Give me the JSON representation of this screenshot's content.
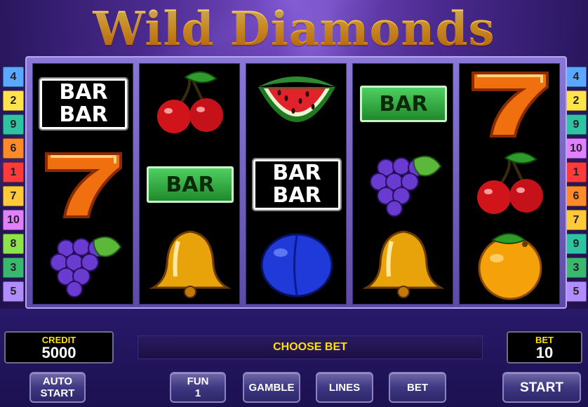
{
  "game": {
    "title_part1": "Wild",
    "title_part2": "Diamonds"
  },
  "paylines_left": [
    "4",
    "2",
    "9",
    "6",
    "1",
    "7",
    "10",
    "8",
    "3",
    "5"
  ],
  "paylines_right": [
    "4",
    "2",
    "9",
    "10",
    "1",
    "6",
    "7",
    "9",
    "3",
    "5"
  ],
  "payline_colors": {
    "4": "#5aa8ff",
    "2": "#ffe34d",
    "9": "#2ec4a3",
    "6": "#ff8a2a",
    "1": "#ff3a3a",
    "7": "#ffc93a",
    "10": "#e080ff",
    "8": "#8ee34d",
    "3": "#3ab870",
    "5": "#b08cff"
  },
  "reels": [
    [
      "bar-double",
      "seven",
      "grapes"
    ],
    [
      "cherry",
      "bar-single",
      "bell"
    ],
    [
      "watermelon",
      "bar-double",
      "plum"
    ],
    [
      "bar-single",
      "grapes",
      "bell"
    ],
    [
      "seven",
      "cherry",
      "orange"
    ]
  ],
  "bar_text": {
    "single": "BAR",
    "double_top": "BAR",
    "double_bottom": "BAR"
  },
  "credit": {
    "label": "CREDIT",
    "value": "5000"
  },
  "bet": {
    "label": "BET",
    "value": "10"
  },
  "message": "CHOOSE BET",
  "buttons": {
    "auto_start_line1": "AUTO",
    "auto_start_line2": "START",
    "fun_line1": "FUN",
    "fun_line2": "1",
    "gamble": "GAMBLE",
    "lines": "LINES",
    "bet": "BET",
    "start": "START"
  }
}
